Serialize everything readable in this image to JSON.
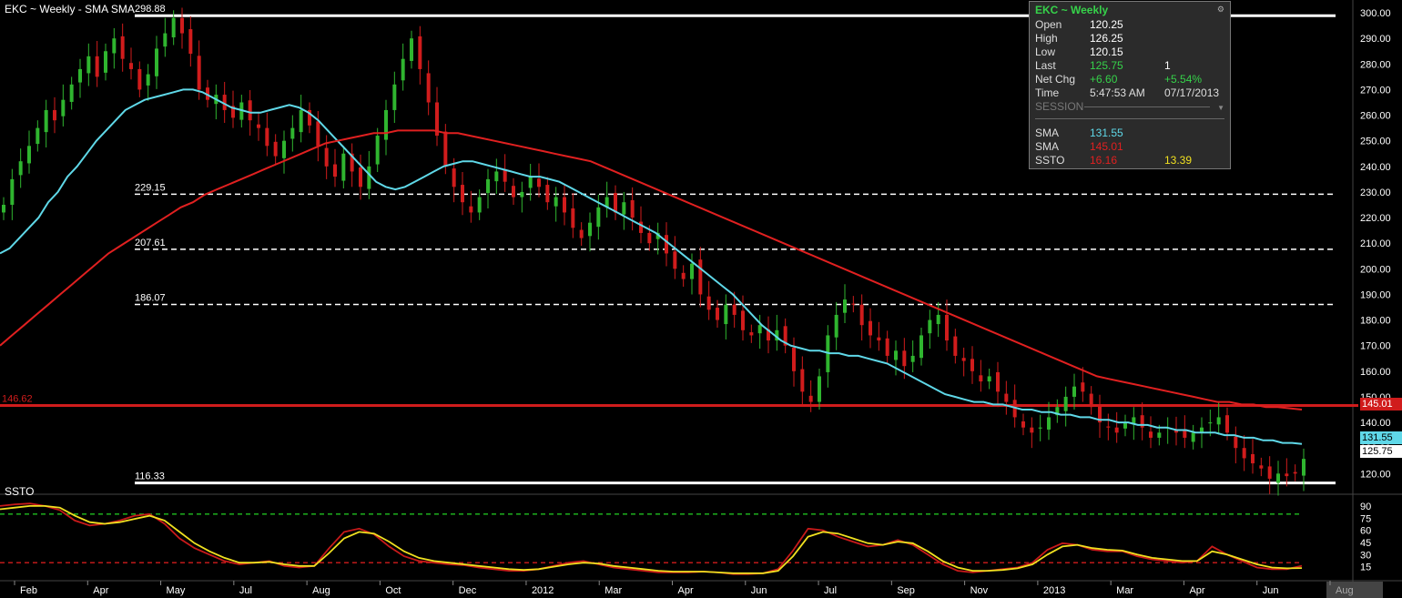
{
  "header": {
    "title": "EKC ~ Weekly  -  SMA SMA"
  },
  "ssto_panel": {
    "label": "SSTO"
  },
  "info_panel": {
    "title": "EKC ~ Weekly",
    "open_label": "Open",
    "open_value": "120.25",
    "high_label": "High",
    "high_value": "126.25",
    "low_label": "Low",
    "low_value": "120.15",
    "last_label": "Last",
    "last_value": "125.75",
    "last_size": "1",
    "netchg_label": "Net Chg",
    "netchg_value": "+6.60",
    "netchg_pct": "+5.54%",
    "time_label": "Time",
    "time_value": "5:47:53 AM",
    "time_date": "07/17/2013",
    "session_label": "SESSION",
    "sma1_label": "SMA",
    "sma1_value": "131.55",
    "sma2_label": "SMA",
    "sma2_value": "145.01",
    "ssto_label": "SSTO",
    "ssto_value": "16.16",
    "ssto_value2": "13.39"
  },
  "price_tags": {
    "sma_slow": "145.01",
    "sma_fast": "131.55",
    "last": "125.75"
  },
  "colors": {
    "background": "#000000",
    "up_candle": "#2fb52f",
    "down_candle": "#d01c1c",
    "sma_fast": "#5fd8e8",
    "sma_slow": "#e02020",
    "ssto_k": "#c81a1a",
    "ssto_d": "#f0e020",
    "fib_line": "#ffffff"
  },
  "chart_data": [
    {
      "type": "candlestick",
      "title": "EKC ~ Weekly",
      "ylim": [
        113,
        305
      ],
      "y_ticks": [
        "300.00",
        "290.00",
        "280.00",
        "270.00",
        "260.00",
        "250.00",
        "240.00",
        "230.00",
        "220.00",
        "210.00",
        "200.00",
        "190.00",
        "180.00",
        "170.00",
        "160.00",
        "150.00",
        "140.00",
        "130.00",
        "120.00"
      ],
      "x_ticks": [
        "Feb",
        "Apr",
        "May",
        "Jul",
        "Aug",
        "Oct",
        "Dec",
        "2012",
        "Mar",
        "Apr",
        "Jun",
        "Jul",
        "Sep",
        "Nov",
        "2013",
        "Mar",
        "Apr",
        "Jun",
        "Aug"
      ],
      "levels": [
        {
          "label": "298.88",
          "value": 298.88,
          "style": "solid"
        },
        {
          "label": "229.15",
          "value": 229.15,
          "style": "dashed"
        },
        {
          "label": "207.61",
          "value": 207.61,
          "style": "dashed"
        },
        {
          "label": "186.07",
          "value": 186.07,
          "style": "dashed"
        },
        {
          "label": "146.62",
          "value": 146.62,
          "style": "solid-red"
        },
        {
          "label": "116.33",
          "value": 116.33,
          "style": "solid"
        }
      ],
      "closes": [
        225,
        235,
        242,
        248,
        255,
        262,
        258,
        266,
        272,
        278,
        283,
        275,
        285,
        290,
        282,
        278,
        270,
        276,
        286,
        292,
        298,
        292,
        284,
        270,
        266,
        268,
        262,
        259,
        265,
        258,
        255,
        248,
        244,
        250,
        255,
        262,
        256,
        248,
        240,
        236,
        245,
        238,
        232,
        240,
        252,
        262,
        272,
        282,
        290,
        278,
        265,
        252,
        240,
        232,
        226,
        222,
        228,
        235,
        238,
        234,
        228,
        230,
        236,
        232,
        226,
        228,
        222,
        216,
        212,
        218,
        224,
        228,
        222,
        226,
        220,
        214,
        210,
        214,
        206,
        200,
        196,
        202,
        190,
        184,
        180,
        186,
        182,
        176,
        174,
        178,
        172,
        176,
        170,
        160,
        152,
        148,
        158,
        174,
        182,
        188,
        186,
        178,
        174,
        172,
        166,
        168,
        162,
        166,
        174,
        180,
        182,
        172,
        166,
        164,
        160,
        156,
        158,
        152,
        148,
        142,
        138,
        136,
        138,
        142,
        146,
        150,
        154,
        152,
        146,
        140,
        138,
        136,
        140,
        142,
        138,
        134,
        136,
        138,
        136,
        134,
        136,
        138,
        140,
        142,
        136,
        130,
        126,
        124,
        122,
        118,
        120,
        119,
        120,
        125.75
      ],
      "series": [
        {
          "name": "SMA",
          "values": [
            206,
            208,
            212,
            216,
            220,
            226,
            230,
            236,
            240,
            245,
            250,
            254,
            258,
            262,
            264,
            266,
            267,
            268,
            269,
            270,
            270,
            269,
            267,
            265,
            263,
            262,
            261,
            261,
            262,
            263,
            264,
            263,
            261,
            258,
            254,
            250,
            246,
            242,
            238,
            234,
            232,
            231,
            232,
            234,
            236,
            238,
            240,
            241,
            242,
            242,
            241,
            240,
            239,
            238,
            237,
            236,
            236,
            235,
            234,
            232,
            230,
            228,
            226,
            224,
            222,
            220,
            218,
            216,
            214,
            211,
            208,
            205,
            202,
            199,
            196,
            193,
            190,
            186,
            182,
            178,
            175,
            172,
            170,
            169,
            168,
            168,
            167,
            167,
            166,
            166,
            165,
            164,
            163,
            161,
            159,
            157,
            155,
            153,
            151,
            150,
            149,
            148,
            148,
            147,
            147,
            146,
            145,
            145,
            144,
            144,
            143,
            143,
            142,
            142,
            141,
            141,
            140,
            140,
            139,
            139,
            138,
            138,
            137,
            137,
            136,
            136,
            136,
            135,
            135,
            134,
            134,
            133,
            133,
            132,
            132,
            131.55
          ]
        },
        {
          "name": "SMA",
          "values": [
            170,
            174,
            178,
            182,
            186,
            190,
            194,
            198,
            202,
            206,
            209,
            212,
            215,
            218,
            221,
            224,
            226,
            229,
            231,
            233,
            235,
            237,
            239,
            241,
            243,
            245,
            247,
            249,
            250,
            251,
            252,
            253,
            253,
            254,
            254,
            254,
            254,
            253,
            253,
            252,
            251,
            250,
            249,
            248,
            247,
            246,
            245,
            244,
            243,
            242,
            240,
            238,
            236,
            234,
            232,
            230,
            228,
            226,
            224,
            222,
            220,
            218,
            216,
            214,
            212,
            210,
            208,
            206,
            204,
            202,
            200,
            198,
            196,
            194,
            192,
            190,
            188,
            186,
            184,
            182,
            180,
            178,
            176,
            174,
            172,
            170,
            168,
            166,
            164,
            162,
            160,
            158,
            157,
            156,
            155,
            154,
            153,
            152,
            151,
            150,
            149,
            148,
            148,
            147,
            147,
            146,
            146,
            145.5,
            145.01
          ]
        }
      ]
    },
    {
      "type": "line",
      "title": "SSTO",
      "ylim": [
        0,
        100
      ],
      "y_ticks": [
        "90",
        "75",
        "60",
        "45",
        "30",
        "15"
      ],
      "levels": [
        80,
        20
      ],
      "series": [
        {
          "name": "SSTO",
          "values": [
            90,
            92,
            93,
            90,
            85,
            72,
            66,
            68,
            72,
            78,
            80,
            68,
            50,
            38,
            30,
            22,
            18,
            20,
            22,
            16,
            14,
            16,
            38,
            58,
            62,
            55,
            40,
            28,
            22,
            20,
            18,
            17,
            14,
            12,
            10,
            10,
            12,
            16,
            20,
            22,
            18,
            14,
            12,
            10,
            8,
            8,
            8,
            9,
            8,
            6,
            6,
            7,
            12,
            35,
            62,
            60,
            52,
            46,
            40,
            42,
            48,
            42,
            30,
            18,
            10,
            8,
            10,
            12,
            14,
            20,
            36,
            44,
            42,
            36,
            34,
            34,
            28,
            24,
            22,
            20,
            22,
            40,
            30,
            22,
            14,
            12,
            12,
            16.16
          ]
        },
        {
          "name": "SSTO",
          "values": [
            86,
            88,
            90,
            90,
            88,
            78,
            70,
            68,
            70,
            74,
            78,
            72,
            58,
            44,
            34,
            26,
            20,
            20,
            21,
            18,
            16,
            16,
            32,
            50,
            58,
            56,
            46,
            34,
            26,
            22,
            20,
            18,
            16,
            14,
            12,
            11,
            12,
            15,
            18,
            20,
            19,
            16,
            14,
            12,
            10,
            9,
            9,
            9,
            8,
            7,
            7,
            7,
            10,
            28,
            52,
            58,
            56,
            50,
            44,
            42,
            46,
            44,
            34,
            22,
            14,
            10,
            10,
            11,
            13,
            18,
            30,
            40,
            42,
            38,
            36,
            35,
            30,
            26,
            24,
            22,
            22,
            34,
            30,
            24,
            18,
            14,
            13,
            13.39
          ]
        }
      ]
    }
  ]
}
